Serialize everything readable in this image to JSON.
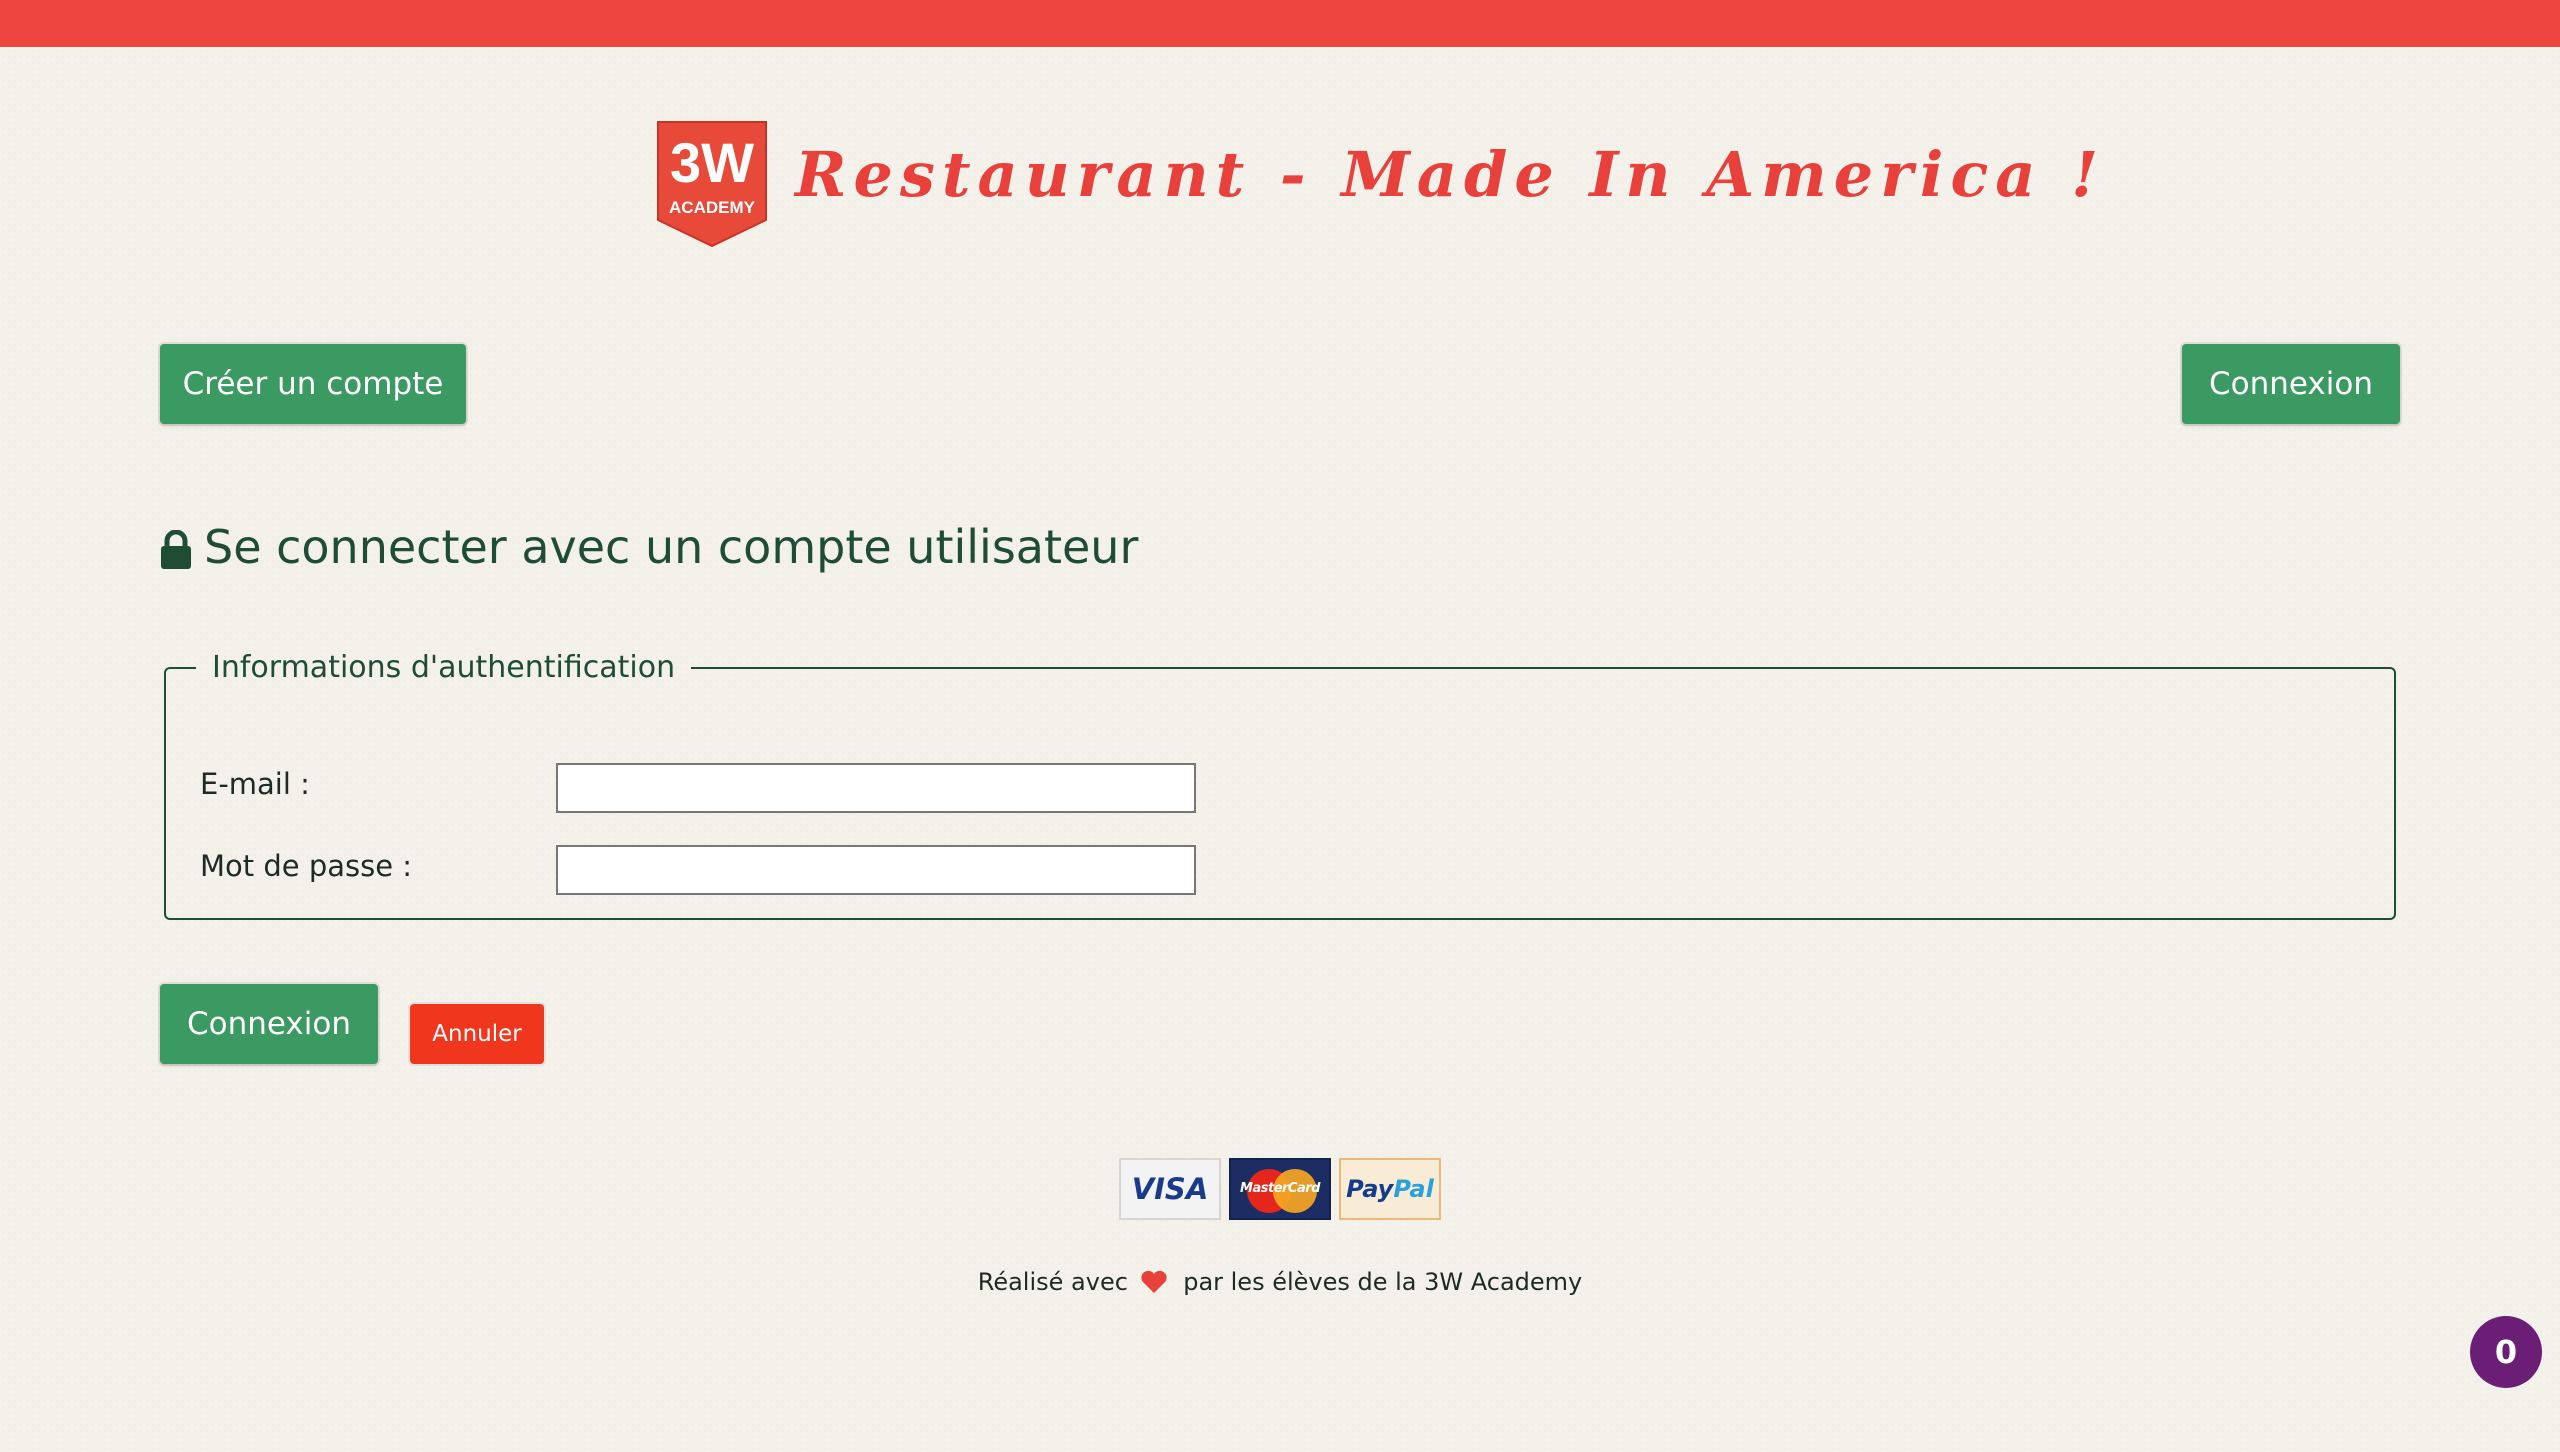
{
  "colors": {
    "brand_red": "#ef4540",
    "title_red": "#e8403b",
    "primary_green": "#3a9a62",
    "dark_green": "#1f4d33",
    "cancel_red": "#f1361e",
    "badge_purple": "#6b1e76",
    "background": "#f4f1ea"
  },
  "header": {
    "logo": {
      "line1": "3W",
      "line2": "ACADEMY"
    },
    "title": "Restaurant - Made In America !"
  },
  "nav": {
    "register_label": "Créer un compte",
    "login_label": "Connexion"
  },
  "login": {
    "heading": "Se connecter avec un compte utilisateur",
    "heading_icon": "lock-icon",
    "fieldset_legend": "Informations d'authentification",
    "email": {
      "label": "E-mail :",
      "value": "",
      "placeholder": ""
    },
    "password": {
      "label": "Mot de passe :",
      "value": "",
      "placeholder": ""
    },
    "submit_label": "Connexion",
    "cancel_label": "Annuler"
  },
  "footer": {
    "payment_methods": {
      "visa": "VISA",
      "mastercard": "MasterCard",
      "paypal_part1": "Pay",
      "paypal_part2": "Pal"
    },
    "credit_before": "Réalisé avec",
    "credit_icon": "heart-icon",
    "credit_after": "par les élèves de la 3W Academy"
  },
  "cart": {
    "count": "0"
  }
}
